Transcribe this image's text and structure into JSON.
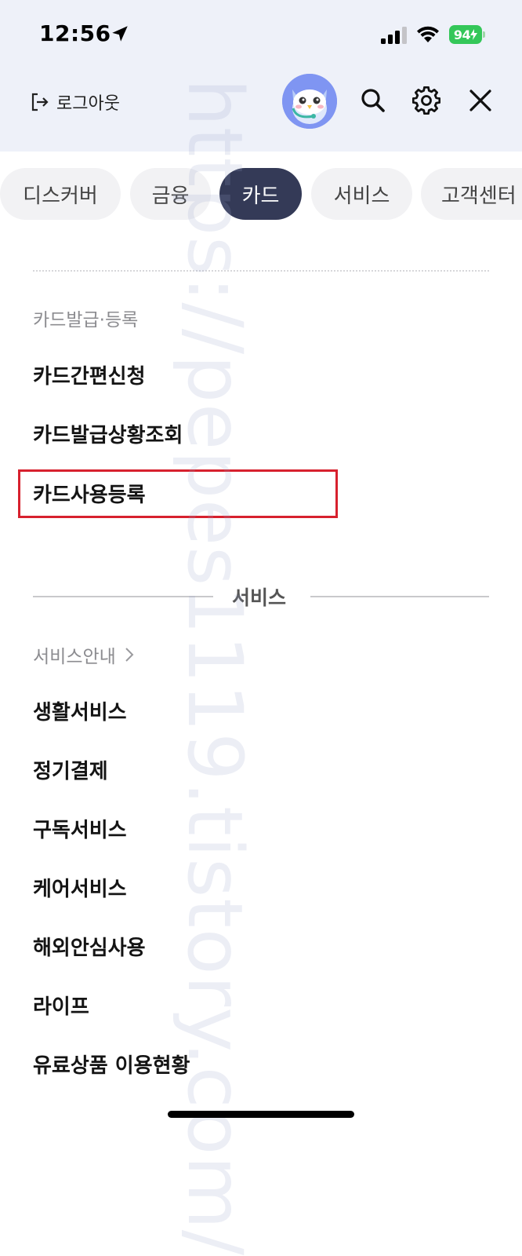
{
  "status_bar": {
    "time": "12:56",
    "battery": "94"
  },
  "header": {
    "logout_label": "로그아웃",
    "avatar_icon": "owl-mascot-icon",
    "icons": [
      "search-icon",
      "gear-icon",
      "close-icon"
    ]
  },
  "tabs": [
    {
      "label": "디스커버",
      "active": false
    },
    {
      "label": "금융",
      "active": false
    },
    {
      "label": "카드",
      "active": true
    },
    {
      "label": "서비스",
      "active": false
    },
    {
      "label": "고객센터",
      "active": false
    }
  ],
  "card_section": {
    "title": "카드발급·등록",
    "items": [
      "카드간편신청",
      "카드발급상황조회",
      "카드사용등록"
    ],
    "highlighted_item": "카드사용등록"
  },
  "service_section": {
    "divider_title": "서비스",
    "guide_label": "서비스안내",
    "items": [
      "생활서비스",
      "정기결제",
      "구독서비스",
      "케어서비스",
      "해외안심사용",
      "라이프",
      "유료상품 이용현황"
    ]
  },
  "watermark": "https://pepes1119.tistory.com/",
  "colors": {
    "header_bg": "#eef1f9",
    "active_tab_bg": "#343a57",
    "tab_bg": "#f2f2f4",
    "highlight_border": "#d7212e",
    "battery_green": "#34c759"
  }
}
